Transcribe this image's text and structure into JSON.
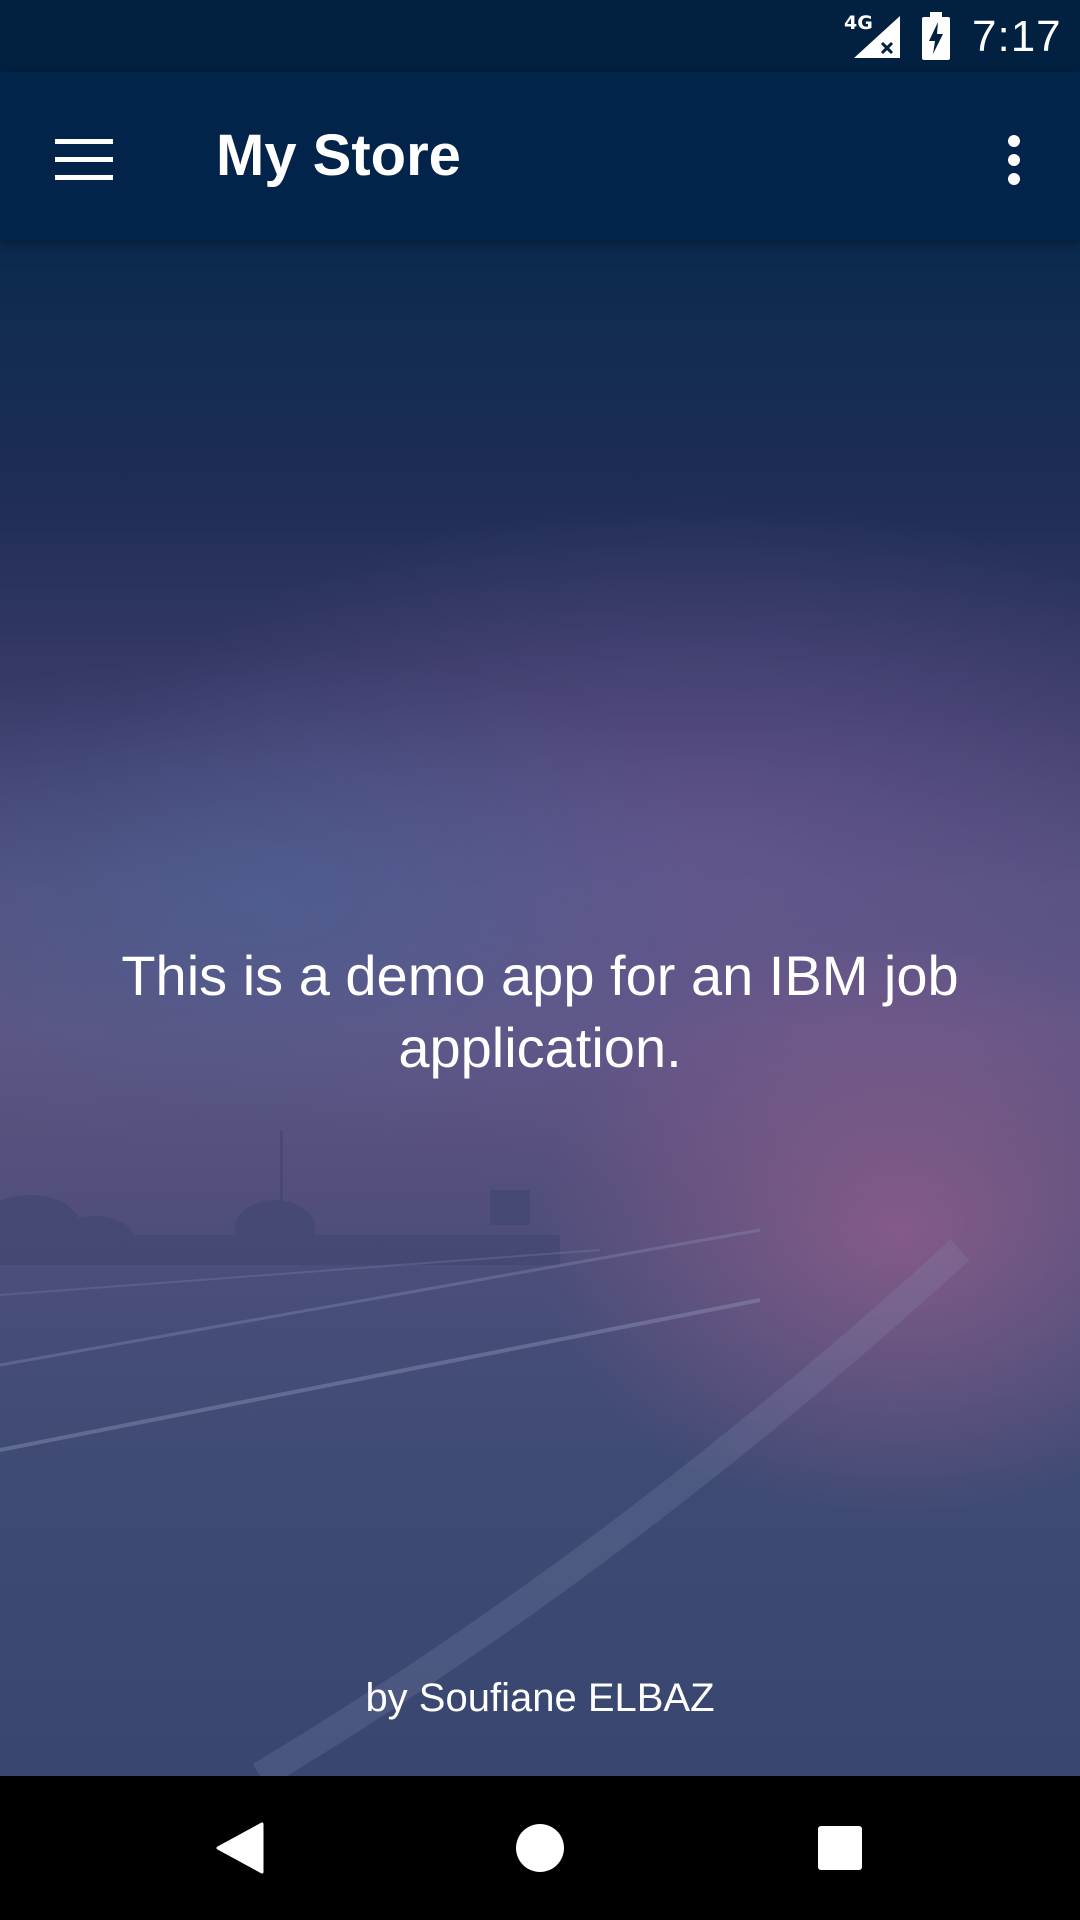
{
  "status_bar": {
    "network": "4G",
    "time": "7:17",
    "icons": [
      "signal-icon",
      "battery-charging-icon"
    ]
  },
  "toolbar": {
    "title": "My Store",
    "menu_icon": "hamburger-menu-icon",
    "overflow_icon": "more-vertical-icon"
  },
  "main": {
    "description": "This is a demo app for an IBM job application.",
    "author": "by Soufiane ELBAZ"
  },
  "nav_bar": {
    "icons": [
      "back-icon",
      "home-icon",
      "recents-icon"
    ]
  },
  "colors": {
    "toolbar": "#02234a",
    "status_bar": "#02203f",
    "text": "#ffffff"
  }
}
